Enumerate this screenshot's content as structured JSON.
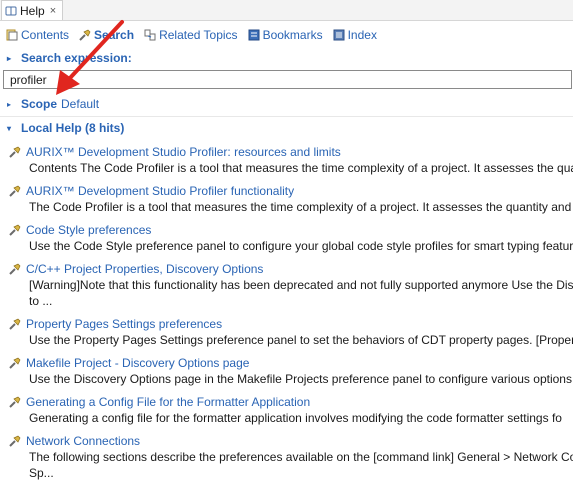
{
  "tab": {
    "title": "Help",
    "close": "×"
  },
  "toolbar": {
    "contents": "Contents",
    "search": "Search",
    "related": "Related Topics",
    "bookmarks": "Bookmarks",
    "index": "Index"
  },
  "search": {
    "section_label": "Search expression:",
    "value": "profiler"
  },
  "scope": {
    "label": "Scope",
    "value": "Default"
  },
  "local_help": {
    "label": "Local Help (8 hits)"
  },
  "results": [
    {
      "title": "AURIX™ Development Studio Profiler: resources and limits",
      "desc": "Contents The Code Profiler is a tool that measures the time complexity of a project. It assesses the quan"
    },
    {
      "title": "AURIX™ Development Studio Profiler functionality",
      "desc": "The Code Profiler is a tool that measures the time complexity of a project. It assesses the quantity and c"
    },
    {
      "title": "Code Style preferences",
      "desc": "Use the Code Style preference panel to configure your global code style profiles for smart typing featur"
    },
    {
      "title": "C/C++ Project Properties, Discovery Options",
      "desc": "[Warning]Note that this functionality has been deprecated and not fully supported anymore Use the Dis",
      "desc2": "to ..."
    },
    {
      "title": "Property Pages Settings preferences",
      "desc": "Use the Property Pages Settings preference panel to set the behaviors of CDT property pages. [Property"
    },
    {
      "title": "Makefile Project - Discovery Options page",
      "desc": "Use the Discovery Options page in the Makefile Projects preference panel to configure various options f"
    },
    {
      "title": "Generating a Config File for the Formatter Application",
      "desc": "Generating a config file for the formatter application involves modifying the code formatter settings fo"
    },
    {
      "title": "Network Connections",
      "desc": "The following sections describe the preferences available on the [command link] General > Network Co",
      "desc2": "Sp..."
    }
  ],
  "colors": {
    "link": "#2a64b4",
    "arrow": "#e0261f"
  }
}
